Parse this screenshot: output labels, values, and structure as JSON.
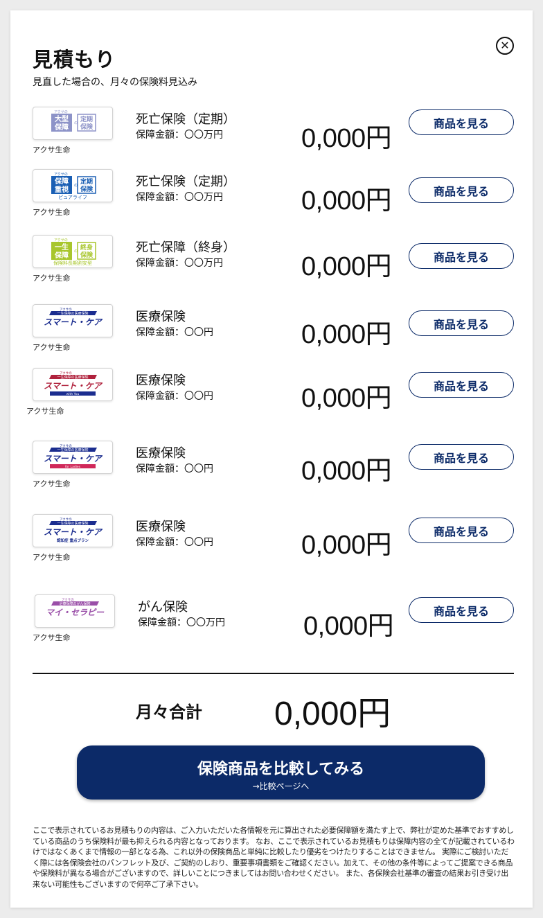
{
  "header": {
    "title": "見積もり",
    "subtitle": "見直した場合の、月々の保険料見込み"
  },
  "products": [
    {
      "type": "死亡保険（定期）",
      "coverage": "保障金額：〇〇万円",
      "price": "0,000円",
      "company": "アクサ生命",
      "button": "商品を見る",
      "logo": {
        "kind": "square",
        "small": "アクサの",
        "left": "大型\n保障",
        "right": "定期\n保険",
        "color": "#8d93c8"
      }
    },
    {
      "type": "死亡保険（定期）",
      "coverage": "保障金額：〇〇万円",
      "price": "0,000円",
      "company": "アクサ生命",
      "button": "商品を見る",
      "logo": {
        "kind": "square",
        "small": "アクサの",
        "left": "保障\n重視",
        "right": "定期\n保険",
        "sub": "ピュアライフ",
        "color": "#1a5fb4"
      }
    },
    {
      "type": "死亡保障（終身）",
      "coverage": "保障金額：〇〇万円",
      "price": "0,000円",
      "company": "アクサ生命",
      "button": "商品を見る",
      "logo": {
        "kind": "square",
        "small": "アクサの",
        "left": "一生\n保障",
        "right": "終身\n保険",
        "sub": "保険料長期割安型",
        "color": "#a8c62c"
      }
    },
    {
      "type": "医療保険",
      "coverage": "保障金額：〇〇円",
      "price": "0,000円",
      "company": "アクサ生命",
      "button": "商品を見る",
      "logo": {
        "kind": "banner",
        "small": "一生保障の医療保険",
        "name": "スマート・ケア",
        "sub": "",
        "color": "#1b2d8f",
        "accent": ""
      }
    },
    {
      "type": "医療保険",
      "coverage": "保障金額：〇〇円",
      "price": "0,000円",
      "company": "アクサ生命",
      "button": "商品を見る",
      "logo": {
        "kind": "banner",
        "small": "一生保障の医療保険",
        "name": "スマート・ケア",
        "sub": "with You",
        "color": "#b0213c",
        "accent": "#1b2d8f"
      }
    },
    {
      "type": "医療保険",
      "coverage": "保障金額：〇〇円",
      "price": "0,000円",
      "company": "アクサ生命",
      "button": "商品を見る",
      "logo": {
        "kind": "banner",
        "small": "一生保障の医療保険",
        "name": "スマート・ケア",
        "sub": "for Ladies",
        "color": "#1b2d8f",
        "accent": "#d0285a"
      }
    },
    {
      "type": "医療保険",
      "coverage": "保障金額：〇〇円",
      "price": "0,000円",
      "company": "アクサ生命",
      "button": "商品を見る",
      "logo": {
        "kind": "banner",
        "small": "一生保障の医療保険",
        "name": "スマート・ケア",
        "sub": "認知症 重点プラン",
        "color": "#1b2d8f",
        "accent": ""
      }
    },
    {
      "type": "がん保険",
      "coverage": "保障金額：〇〇万円",
      "price": "0,000円",
      "company": "アクサ生命",
      "button": "商品を見る",
      "logo": {
        "kind": "banner",
        "small": "治療保障のがん保険",
        "name": "マイ・セラピー",
        "sub": "",
        "color": "#9a4fa8",
        "accent": ""
      }
    }
  ],
  "summary": {
    "label": "月々合計",
    "total": "0,000円"
  },
  "compare": {
    "label": "保険商品を比較してみる",
    "sub": "→比較ページへ"
  },
  "disclaimer": "ここで表示されているお見積もりの内容は、ご入力いただいた各情報を元に算出された必要保障額を満たす上で、弊社が定めた基準でおすすめしている商品のうち保険料が最も抑えられる内容となっております。 なお、ここで表示されているお見積もりは保障内容の全てが記載されているわけではなくあくまで情報の一部となる為、これ以外の保険商品と単純に比較したり優劣をつけたりすることはできません。 実際にご検討いただく際には各保険会社のパンフレット及び、ご契約のしおり、重要事項書類をご確認ください。加えて、その他の条件等によってご提案できる商品や保険料が異なる場合がございますので、詳しいことにつきましてはお問い合わせください。 また、各保険会社基準の審査の結果お引き受け出来ない可能性もございますので何卒ご了承下さい。",
  "icons": {
    "close": "close-circle-icon"
  }
}
